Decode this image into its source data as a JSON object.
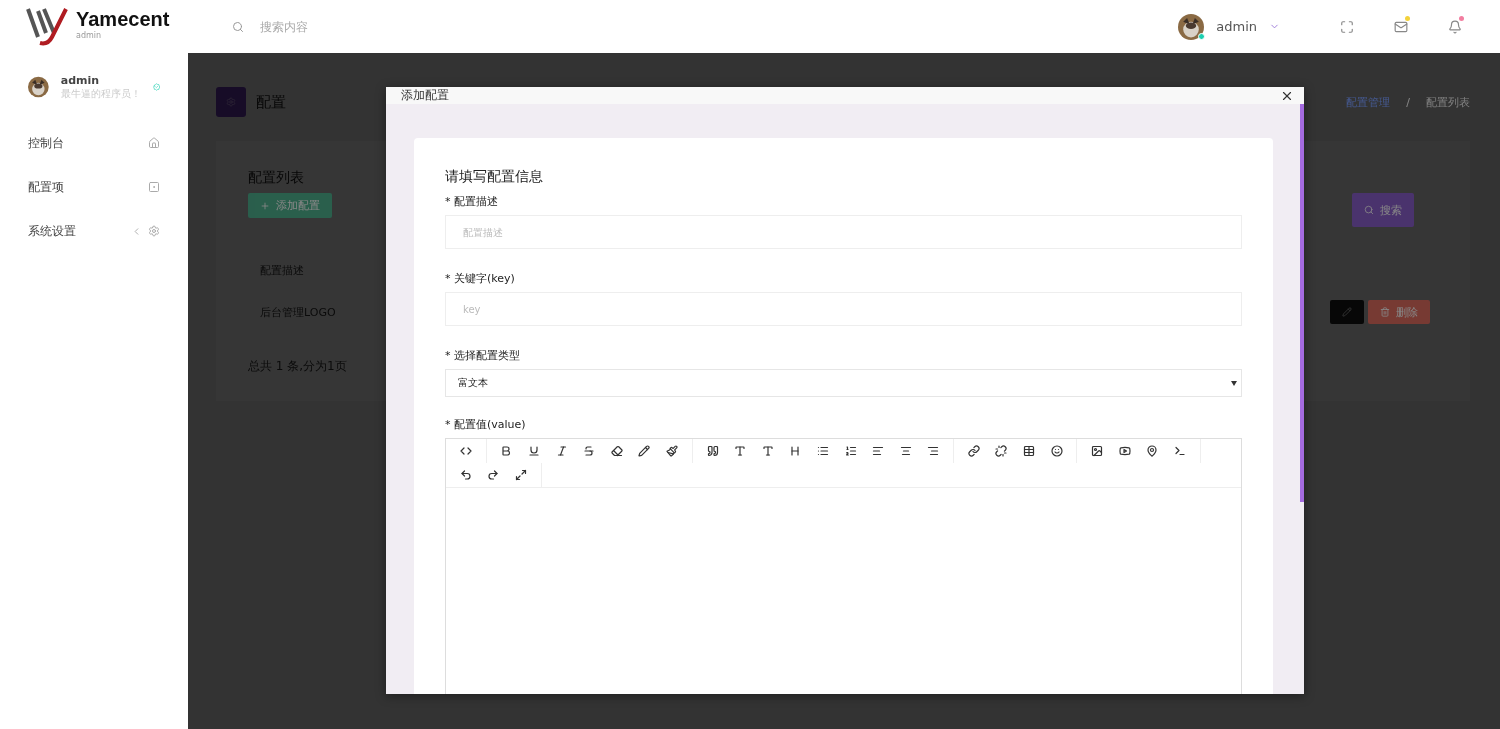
{
  "brand": {
    "name": "Yamecent",
    "subtitle": "admin"
  },
  "search": {
    "placeholder": "搜索内容"
  },
  "user_menu": {
    "name": "admin",
    "online": true
  },
  "header_icons": [
    {
      "kind": "fullscreen",
      "badge": false
    },
    {
      "kind": "mail",
      "badge": true,
      "color": "#f3d23b"
    },
    {
      "kind": "bell",
      "badge": true,
      "color": "#f27ea0"
    }
  ],
  "profile": {
    "name": "admin",
    "motto": "最牛逼的程序员！",
    "verified": true
  },
  "sidebar": {
    "items": [
      {
        "label": "控制台",
        "kind": "home",
        "expandable": false
      },
      {
        "label": "配置项",
        "kind": "config",
        "expandable": false
      },
      {
        "label": "系统设置",
        "kind": "gear",
        "expandable": true
      }
    ]
  },
  "page": {
    "title": "配置",
    "breadcrumb": [
      "配置管理",
      "配置列表"
    ],
    "breadcrumb_separator": "/"
  },
  "list": {
    "title": "配置列表",
    "add_button": "添加配置",
    "search_button": "搜索",
    "columns": [
      "配置描述"
    ],
    "rows": [
      {
        "cells": [
          "后台管理LOGO"
        ],
        "delete_button": "删除"
      }
    ],
    "footer": "总共 1 条,分为1页"
  },
  "modal": {
    "title": "添加配置",
    "form_title": "请填写配置信息",
    "fields": [
      {
        "kind": "text",
        "label": "* 配置描述",
        "placeholder": "配置描述"
      },
      {
        "kind": "text",
        "label": "* 关键字(key)",
        "placeholder": "key"
      },
      {
        "kind": "select",
        "label": "* 选择配置类型",
        "value": "富文本"
      },
      {
        "kind": "editor",
        "label": "* 配置值(value)"
      }
    ]
  }
}
